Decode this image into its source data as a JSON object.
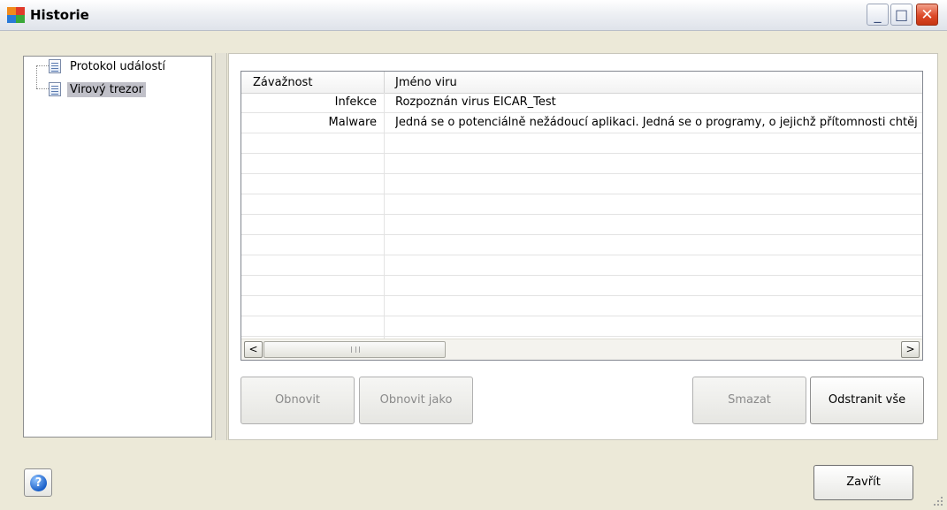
{
  "window": {
    "title": "Historie",
    "controls": {
      "minimize": "_",
      "maximize": "□",
      "close": "✕"
    }
  },
  "tree": {
    "items": [
      {
        "label": "Protokol událostí",
        "selected": false
      },
      {
        "label": "Virový trezor",
        "selected": true
      }
    ]
  },
  "table": {
    "columns": [
      "Závažnost",
      "Jméno viru"
    ],
    "rows": [
      {
        "severity": "Infekce",
        "name": "Rozpoznán virus EICAR_Test"
      },
      {
        "severity": "Malware",
        "name": "Jedná se o potenciálně nežádoucí aplikaci. Jedná se o programy, o jejichž přítomnosti chtějí"
      }
    ],
    "empty_rows": 10,
    "scroll_left": "<",
    "scroll_right": ">",
    "scroll_grip": "III"
  },
  "actions": {
    "restore": "Obnovit",
    "restore_as": "Obnovit jako",
    "delete": "Smazat",
    "remove_all": "Odstranit vše"
  },
  "footer": {
    "help": "?",
    "close": "Zavřít"
  },
  "icons": {
    "app": "avg-logo-icon",
    "tree_item": "document-list-icon",
    "help": "help-icon"
  },
  "colors": {
    "selection": "#c0c0c8",
    "window_bg": "#ece9d8",
    "close_button": "#dd4a2a"
  }
}
